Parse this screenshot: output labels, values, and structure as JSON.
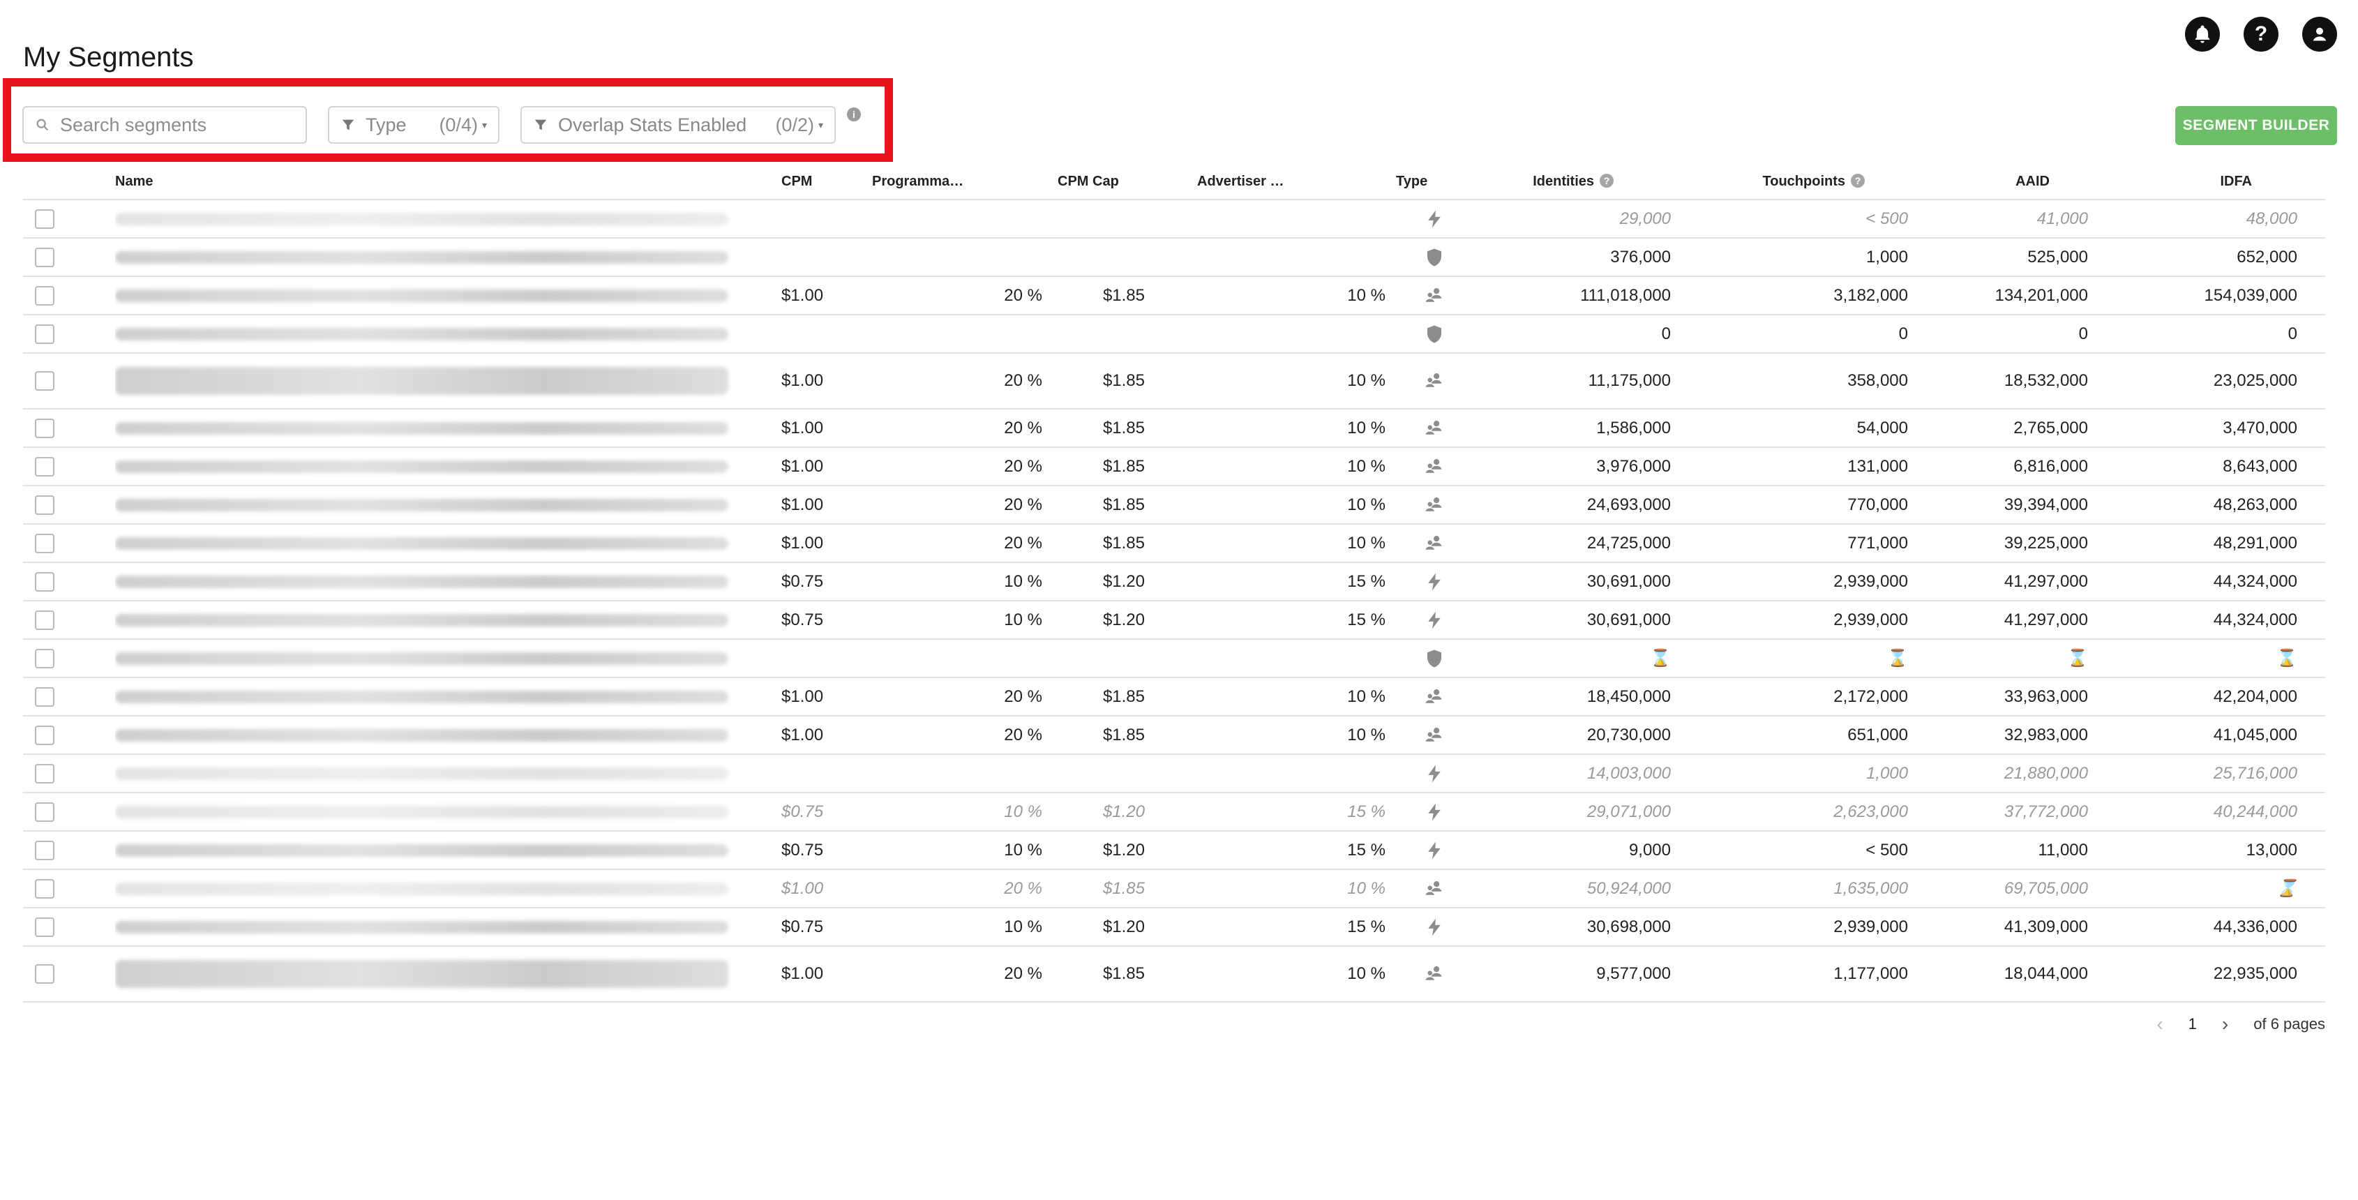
{
  "page": {
    "title": "My Segments"
  },
  "header_icons": [
    "bell-icon",
    "help-icon",
    "account-icon"
  ],
  "filters": {
    "search_placeholder": "Search segments",
    "type_label": "Type",
    "type_count": "(0/4)",
    "overlap_label": "Overlap Stats Enabled",
    "overlap_count": "(0/2)"
  },
  "builder_button": "SEGMENT BUILDER",
  "columns": {
    "name": "Name",
    "cpm": "CPM",
    "programmatic": "Programma…",
    "cpm_cap": "CPM Cap",
    "advertiser": "Advertiser …",
    "type": "Type",
    "identities": "Identities",
    "touchpoints": "Touchpoints",
    "aaid": "AAID",
    "idfa": "IDFA"
  },
  "rows": [
    {
      "dim": true,
      "tall": false,
      "cpm": "",
      "prog": "",
      "cap": "",
      "adv": "",
      "type": "bolt",
      "ident": "29,000",
      "touch": "< 500",
      "aaid": "41,000",
      "idfa": "48,000"
    },
    {
      "dim": false,
      "tall": false,
      "cpm": "",
      "prog": "",
      "cap": "",
      "adv": "",
      "type": "shield",
      "ident": "376,000",
      "touch": "1,000",
      "aaid": "525,000",
      "idfa": "652,000"
    },
    {
      "dim": false,
      "tall": false,
      "cpm": "$1.00",
      "prog": "20 %",
      "cap": "$1.85",
      "adv": "10 %",
      "type": "people",
      "ident": "111,018,000",
      "touch": "3,182,000",
      "aaid": "134,201,000",
      "idfa": "154,039,000"
    },
    {
      "dim": false,
      "tall": false,
      "cpm": "",
      "prog": "",
      "cap": "",
      "adv": "",
      "type": "shield",
      "ident": "0",
      "touch": "0",
      "aaid": "0",
      "idfa": "0"
    },
    {
      "dim": false,
      "tall": true,
      "cpm": "$1.00",
      "prog": "20 %",
      "cap": "$1.85",
      "adv": "10 %",
      "type": "people",
      "ident": "11,175,000",
      "touch": "358,000",
      "aaid": "18,532,000",
      "idfa": "23,025,000"
    },
    {
      "dim": false,
      "tall": false,
      "cpm": "$1.00",
      "prog": "20 %",
      "cap": "$1.85",
      "adv": "10 %",
      "type": "people",
      "ident": "1,586,000",
      "touch": "54,000",
      "aaid": "2,765,000",
      "idfa": "3,470,000"
    },
    {
      "dim": false,
      "tall": false,
      "cpm": "$1.00",
      "prog": "20 %",
      "cap": "$1.85",
      "adv": "10 %",
      "type": "people",
      "ident": "3,976,000",
      "touch": "131,000",
      "aaid": "6,816,000",
      "idfa": "8,643,000"
    },
    {
      "dim": false,
      "tall": false,
      "cpm": "$1.00",
      "prog": "20 %",
      "cap": "$1.85",
      "adv": "10 %",
      "type": "people",
      "ident": "24,693,000",
      "touch": "770,000",
      "aaid": "39,394,000",
      "idfa": "48,263,000"
    },
    {
      "dim": false,
      "tall": false,
      "cpm": "$1.00",
      "prog": "20 %",
      "cap": "$1.85",
      "adv": "10 %",
      "type": "people",
      "ident": "24,725,000",
      "touch": "771,000",
      "aaid": "39,225,000",
      "idfa": "48,291,000"
    },
    {
      "dim": false,
      "tall": false,
      "cpm": "$0.75",
      "prog": "10 %",
      "cap": "$1.20",
      "adv": "15 %",
      "type": "bolt",
      "ident": "30,691,000",
      "touch": "2,939,000",
      "aaid": "41,297,000",
      "idfa": "44,324,000"
    },
    {
      "dim": false,
      "tall": false,
      "cpm": "$0.75",
      "prog": "10 %",
      "cap": "$1.20",
      "adv": "15 %",
      "type": "bolt",
      "ident": "30,691,000",
      "touch": "2,939,000",
      "aaid": "41,297,000",
      "idfa": "44,324,000"
    },
    {
      "dim": false,
      "tall": false,
      "cpm": "",
      "prog": "",
      "cap": "",
      "adv": "",
      "type": "shield",
      "ident": "⌛",
      "touch": "⌛",
      "aaid": "⌛",
      "idfa": "⌛"
    },
    {
      "dim": false,
      "tall": false,
      "cpm": "$1.00",
      "prog": "20 %",
      "cap": "$1.85",
      "adv": "10 %",
      "type": "people",
      "ident": "18,450,000",
      "touch": "2,172,000",
      "aaid": "33,963,000",
      "idfa": "42,204,000"
    },
    {
      "dim": false,
      "tall": false,
      "cpm": "$1.00",
      "prog": "20 %",
      "cap": "$1.85",
      "adv": "10 %",
      "type": "people",
      "ident": "20,730,000",
      "touch": "651,000",
      "aaid": "32,983,000",
      "idfa": "41,045,000"
    },
    {
      "dim": true,
      "tall": false,
      "cpm": "",
      "prog": "",
      "cap": "",
      "adv": "",
      "type": "bolt",
      "ident": "14,003,000",
      "touch": "1,000",
      "aaid": "21,880,000",
      "idfa": "25,716,000"
    },
    {
      "dim": true,
      "tall": false,
      "cpm": "$0.75",
      "prog": "10 %",
      "cap": "$1.20",
      "adv": "15 %",
      "type": "bolt",
      "ident": "29,071,000",
      "touch": "2,623,000",
      "aaid": "37,772,000",
      "idfa": "40,244,000"
    },
    {
      "dim": false,
      "tall": false,
      "cpm": "$0.75",
      "prog": "10 %",
      "cap": "$1.20",
      "adv": "15 %",
      "type": "bolt",
      "ident": "9,000",
      "touch": "< 500",
      "aaid": "11,000",
      "idfa": "13,000"
    },
    {
      "dim": true,
      "tall": false,
      "cpm": "$1.00",
      "prog": "20 %",
      "cap": "$1.85",
      "adv": "10 %",
      "type": "people",
      "ident": "50,924,000",
      "touch": "1,635,000",
      "aaid": "69,705,000",
      "idfa": "⌛"
    },
    {
      "dim": false,
      "tall": false,
      "cpm": "$0.75",
      "prog": "10 %",
      "cap": "$1.20",
      "adv": "15 %",
      "type": "bolt",
      "ident": "30,698,000",
      "touch": "2,939,000",
      "aaid": "41,309,000",
      "idfa": "44,336,000"
    },
    {
      "dim": false,
      "tall": true,
      "cpm": "$1.00",
      "prog": "20 %",
      "cap": "$1.85",
      "adv": "10 %",
      "type": "people",
      "ident": "9,577,000",
      "touch": "1,177,000",
      "aaid": "18,044,000",
      "idfa": "22,935,000"
    }
  ],
  "pagination": {
    "current": "1",
    "total_label": "of 6 pages"
  },
  "colors": {
    "accent_green": "#6dbf67",
    "highlight_red": "#e8141b",
    "icon_gray": "#8c8c8c"
  }
}
